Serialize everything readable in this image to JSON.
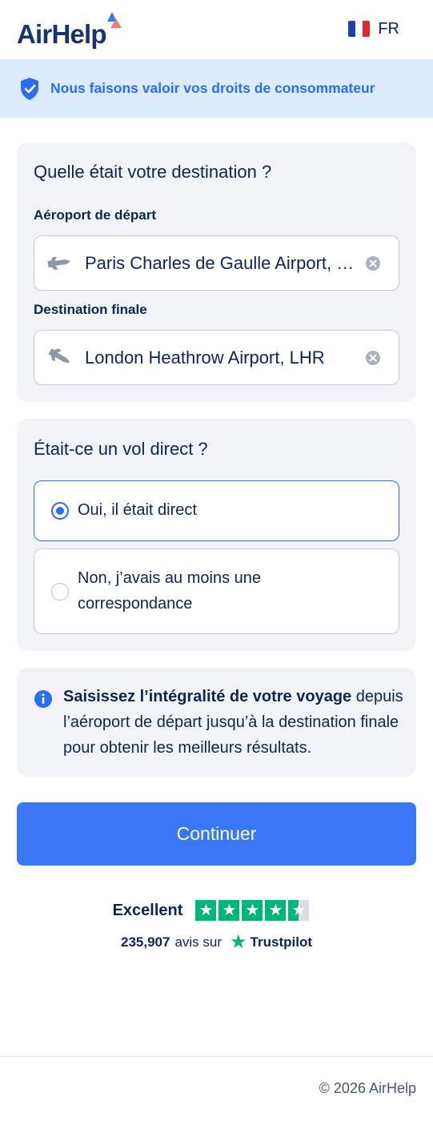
{
  "header": {
    "logo_text": "AirHelp",
    "language": "FR",
    "flag_colors": [
      "#1f3fa6",
      "#ffffff",
      "#e3262b"
    ]
  },
  "banner": {
    "text": "Nous faisons valoir vos droits de consommateur",
    "icon": "shield-check-icon"
  },
  "destination_card": {
    "title": "Quelle était votre destination ?",
    "departure": {
      "label": "Aéroport de départ",
      "value": "Paris Charles de Gaulle Airport, CDG",
      "icon": "plane-takeoff-icon"
    },
    "arrival": {
      "label": "Destination finale",
      "value": "London Heathrow Airport, LHR",
      "icon": "plane-landing-icon"
    }
  },
  "direct_card": {
    "title": "Était-ce un vol direct ?",
    "options": [
      {
        "label": "Oui, il était direct",
        "selected": true
      },
      {
        "label": "Non, j’avais au moins une correspondance",
        "selected": false
      }
    ]
  },
  "info_card": {
    "bold": "Saisissez l’intégralité de votre voyage",
    "rest": " depuis l’aéroport de départ jusqu’à la destination finale pour obtenir les meilleurs résultats."
  },
  "cta": {
    "label": "Continuer"
  },
  "trustpilot": {
    "rating_label": "Excellent",
    "stars": 4.5,
    "count": "235,907",
    "avis_sur": "avis sur",
    "brand": "Trustpilot"
  },
  "footer": {
    "copyright": "© 2026 AirHelp"
  },
  "colors": {
    "accent": "#3a77f7",
    "trustpilot_green": "#00b67a",
    "navy": "#0e2453"
  }
}
